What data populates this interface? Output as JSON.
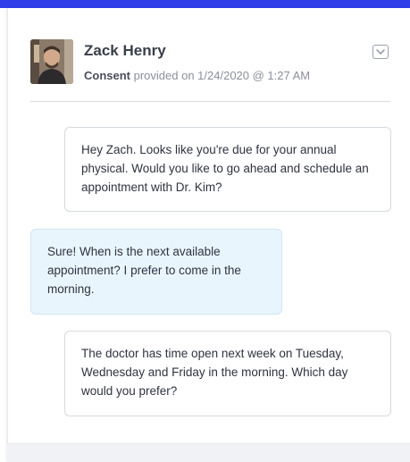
{
  "header": {
    "contact_name": "Zack Henry",
    "consent_label": "Consent",
    "consent_text": "provided on 1/24/2020 @ 1:27 AM",
    "avatar_icon": "user-photo",
    "dropdown_icon": "chevron-down-icon"
  },
  "colors": {
    "top_bar": "#2f3ee8",
    "incoming_bubble": "#e9f5fd",
    "outgoing_bubble": "#ffffff"
  },
  "messages": [
    {
      "direction": "outgoing",
      "text": "Hey Zach. Looks like you're due for your annual physical. Would you like to go ahead and schedule an appointment with Dr. Kim?"
    },
    {
      "direction": "incoming",
      "text": "Sure! When is the next available appointment? I prefer to come in the morning."
    },
    {
      "direction": "outgoing",
      "text": "The doctor has time open next week on Tuesday, Wednesday and Friday in the morning. Which day would you prefer?"
    }
  ]
}
